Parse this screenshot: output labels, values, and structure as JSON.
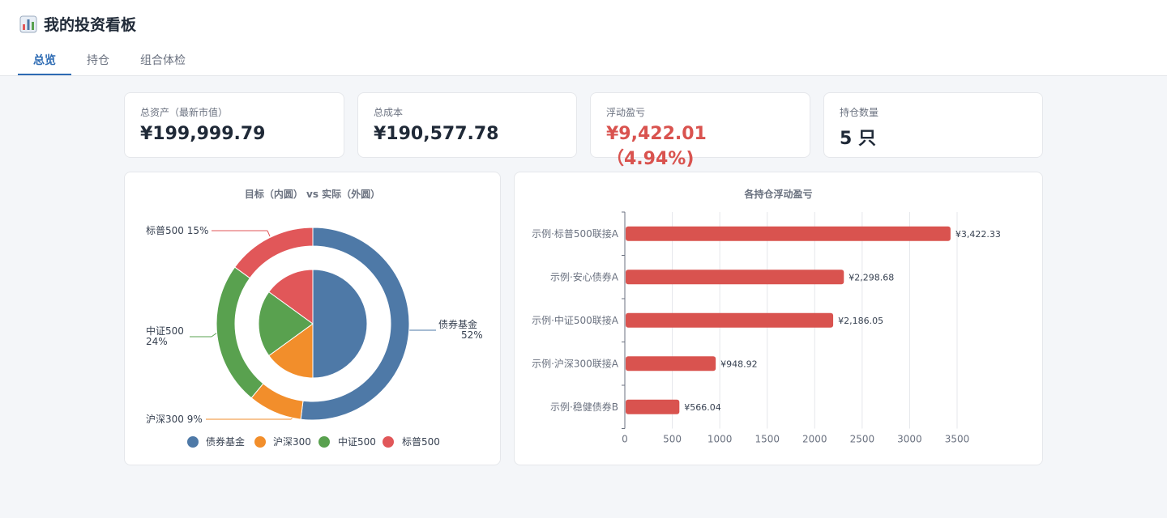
{
  "header": {
    "title": "我的投资看板",
    "icon": "bar-chart-icon"
  },
  "tabs": [
    {
      "label": "总览",
      "active": true
    },
    {
      "label": "持仓",
      "active": false
    },
    {
      "label": "组合体检",
      "active": false
    }
  ],
  "kpis": [
    {
      "label": "总资产（最新市值）",
      "value": "¥199,999.79"
    },
    {
      "label": "总成本",
      "value": "¥190,577.78"
    },
    {
      "label": "浮动盈亏",
      "value": "¥9,422.01（4.94%)"
    },
    {
      "label": "持仓数量",
      "value": "5 只"
    }
  ],
  "colors": {
    "accent": "#2d6bb3",
    "loss": "#d9534f",
    "bond": "#4e79a7",
    "hs300": "#f28e2b",
    "zz500": "#59a14f",
    "sp500": "#e15759"
  },
  "chart_data": [
    {
      "type": "pie",
      "title": "目标（内圆） vs 实际（外圆）",
      "categories": [
        "债券基金",
        "沪深300",
        "中证500",
        "标普500"
      ],
      "series": [
        {
          "values": [
            52,
            9,
            24,
            15
          ]
        },
        {
          "values": [
            50,
            15,
            20,
            15
          ]
        }
      ],
      "labels": [
        "债券基金",
        "52%",
        "沪深300 9%",
        "中证500",
        "24%",
        "标普500 15%"
      ],
      "legend": "bottom"
    },
    {
      "type": "bar",
      "title": "各持仓浮动盈亏",
      "categories": [
        "示例·标普500联接A",
        "示例·安心债券A",
        "示例·中证500联接A",
        "示例·沪深300联接A",
        "示例·稳健债券B"
      ],
      "values": [
        3422.33,
        2298.68,
        2186.05,
        948.92,
        566.04
      ],
      "value_labels": [
        "¥3,422.33",
        "¥2,298.68",
        "¥2,186.05",
        "¥948.92",
        "¥566.04"
      ],
      "xticks": [
        "0",
        "500",
        "1000",
        "1500",
        "2000",
        "2500",
        "3000",
        "3500"
      ],
      "xlim": [
        0,
        3500
      ],
      "orientation": "horizontal",
      "grid": true
    }
  ]
}
